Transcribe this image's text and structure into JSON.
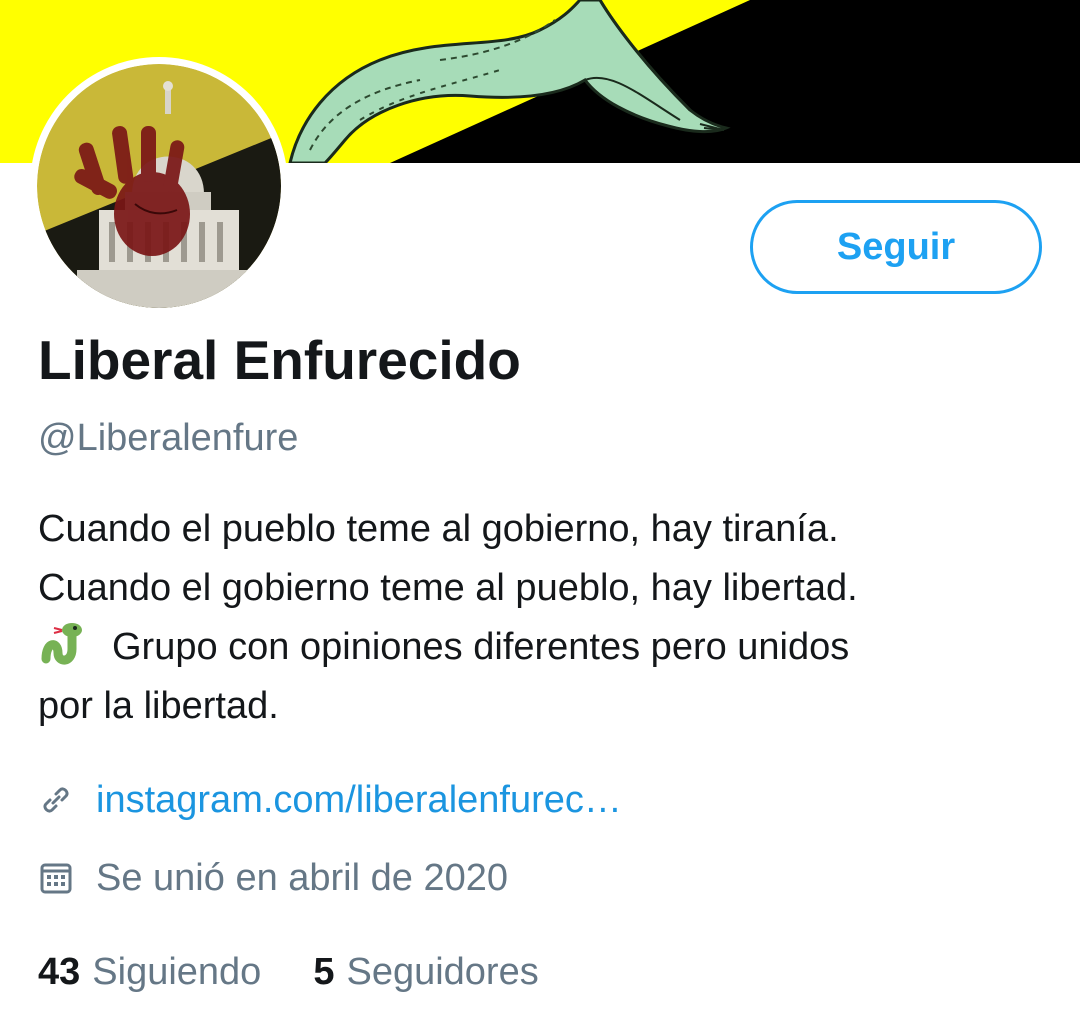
{
  "profile": {
    "follow_button_label": "Seguir",
    "display_name": "Liberal Enfurecido",
    "handle": "@Liberalenfure",
    "bio": {
      "line1": "Cuando el pueblo teme al gobierno, hay tiranía.",
      "line2": "Cuando el gobierno teme al pueblo, hay libertad.",
      "line3": "Grupo con opiniones diferentes pero unidos",
      "line4": "por la libertad."
    },
    "website": "instagram.com/liberalenfurec…",
    "joined": "Se unió en abril de 2020",
    "following": {
      "count": "43",
      "label": "Siguiendo"
    },
    "followers": {
      "count": "5",
      "label": "Seguidores"
    }
  },
  "icons": {
    "link": "link-icon",
    "calendar": "calendar-icon",
    "bio_emoji": "snake-emoji"
  },
  "colors": {
    "accent": "#1da1f2",
    "link": "#1b95e0",
    "primary_text": "#14171a",
    "secondary_text": "#657786",
    "banner_yellow": "#ffff00",
    "banner_black": "#000000",
    "snake_green": "#a7dcb8"
  }
}
